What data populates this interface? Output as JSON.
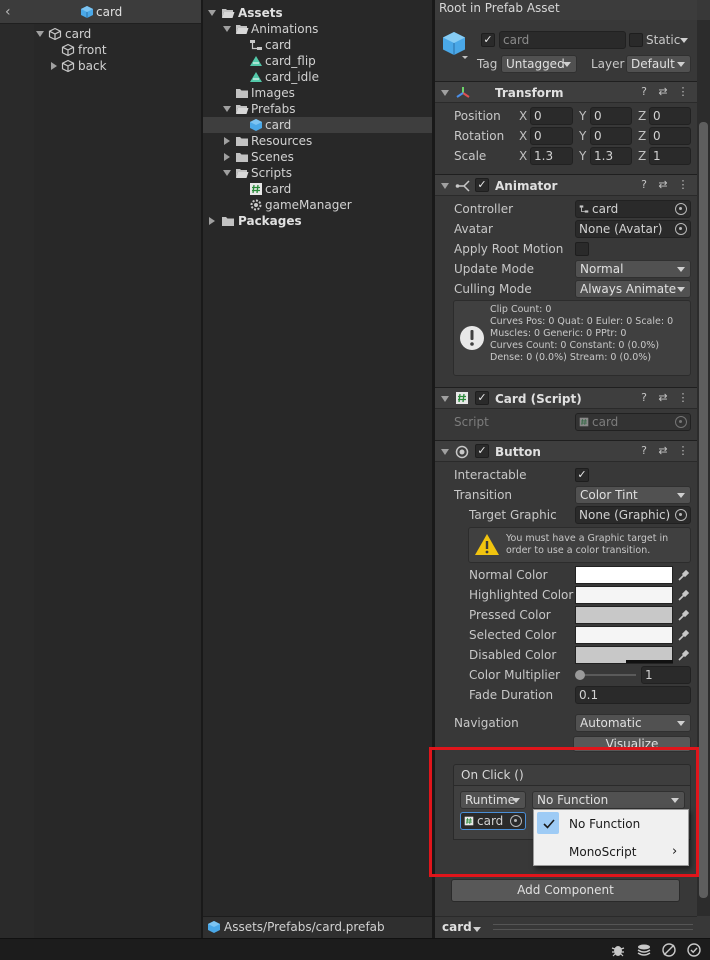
{
  "hierarchy": {
    "header_title": "card",
    "items": [
      {
        "label": "card",
        "depth": 0
      },
      {
        "label": "front",
        "depth": 1
      },
      {
        "label": "back",
        "depth": 1
      }
    ]
  },
  "project": {
    "items": [
      {
        "label": "Assets"
      },
      {
        "label": "Animations"
      },
      {
        "label": "card"
      },
      {
        "label": "card_flip"
      },
      {
        "label": "card_idle"
      },
      {
        "label": "Images"
      },
      {
        "label": "Prefabs"
      },
      {
        "label": "card"
      },
      {
        "label": "Resources"
      },
      {
        "label": "Scenes"
      },
      {
        "label": "Scripts"
      },
      {
        "label": "card"
      },
      {
        "label": "gameManager"
      },
      {
        "label": "Packages"
      }
    ],
    "path": "Assets/Prefabs/card.prefab"
  },
  "inspector": {
    "header": "Root in Prefab Asset",
    "object_name": "card",
    "static_label": "Static",
    "tag_label": "Tag",
    "tag_value": "Untagged",
    "layer_label": "Layer",
    "layer_value": "Default",
    "transform": {
      "title": "Transform",
      "position_label": "Position",
      "rotation_label": "Rotation",
      "scale_label": "Scale",
      "position": {
        "x": "0",
        "y": "0",
        "z": "0"
      },
      "rotation": {
        "x": "0",
        "y": "0",
        "z": "0"
      },
      "scale": {
        "x": "1.3",
        "y": "1.3",
        "z": "1"
      },
      "axis_x": "X",
      "axis_y": "Y",
      "axis_z": "Z"
    },
    "animator": {
      "title": "Animator",
      "controller_label": "Controller",
      "controller_value": "card",
      "avatar_label": "Avatar",
      "avatar_value": "None (Avatar)",
      "apply_root_motion_label": "Apply Root Motion",
      "update_mode_label": "Update Mode",
      "update_mode_value": "Normal",
      "culling_mode_label": "Culling Mode",
      "culling_mode_value": "Always Animate",
      "info_lines": [
        "Clip Count: 0",
        "Curves Pos: 0 Quat: 0 Euler: 0 Scale: 0",
        "Muscles: 0 Generic: 0 PPtr: 0",
        "Curves Count: 0 Constant: 0 (0.0%)",
        "Dense: 0 (0.0%) Stream: 0 (0.0%)"
      ]
    },
    "card_script": {
      "title": "Card (Script)",
      "script_label": "Script",
      "script_value": "card"
    },
    "button": {
      "title": "Button",
      "interactable_label": "Interactable",
      "transition_label": "Transition",
      "transition_value": "Color Tint",
      "target_graphic_label": "Target Graphic",
      "target_graphic_value": "None (Graphic)",
      "warning_lines": [
        "You must have a Graphic target in",
        "order to use a color transition."
      ],
      "normal_color_label": "Normal Color",
      "highlighted_color_label": "Highlighted Color",
      "pressed_color_label": "Pressed Color",
      "selected_color_label": "Selected Color",
      "disabled_color_label": "Disabled Color",
      "color_multiplier_label": "Color Multiplier",
      "color_multiplier_value": "1",
      "color_multiplier_level": 0,
      "fade_duration_label": "Fade Duration",
      "fade_duration_value": "0.1",
      "navigation_label": "Navigation",
      "navigation_value": "Automatic",
      "visualize_label": "Visualize",
      "on_click_label": "On Click ()",
      "runtime_value": "Runtime",
      "function_value": "No Function",
      "target_object": "card"
    },
    "add_component_label": "Add Component"
  },
  "context_menu": {
    "items": [
      "No Function",
      "MonoScript"
    ],
    "checked_index": 0
  },
  "bottom": {
    "object_label": "card"
  },
  "colors": {
    "highlight_border": "#e0151b",
    "accent_blue": "#4aa8e8",
    "warning_yellow": "#f1c40f"
  }
}
